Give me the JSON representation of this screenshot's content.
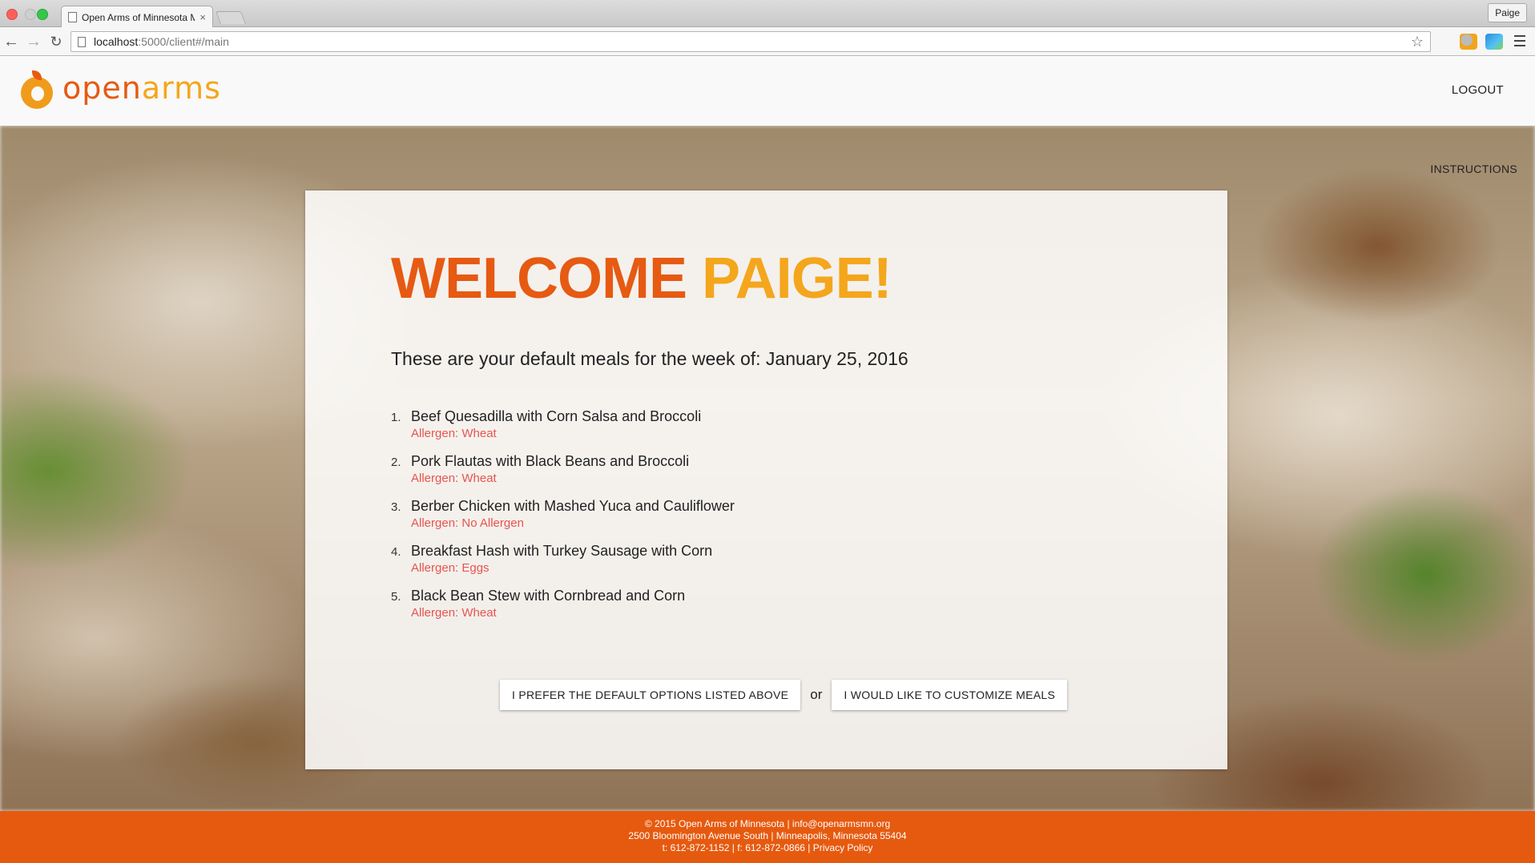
{
  "browser": {
    "tab_title": "Open Arms of Minnesota M",
    "tab_close": "×",
    "profile_name": "Paige",
    "url_host": "localhost",
    "url_rest": ":5000/client#/main"
  },
  "header": {
    "logo_open": "open",
    "logo_arms": "arms",
    "logout_label": "LOGOUT",
    "instructions_label": "INSTRUCTIONS"
  },
  "main": {
    "welcome_word": "WELCOME",
    "user_name": "PAIGE!",
    "subtitle_prefix": "These are your default meals for the week of:",
    "week_date": "January 25, 2016",
    "meals": [
      {
        "num": "1.",
        "name": "Beef Quesadilla with Corn Salsa and Broccoli",
        "allergen": "Allergen: Wheat"
      },
      {
        "num": "2.",
        "name": "Pork Flautas with Black Beans and Broccoli",
        "allergen": "Allergen: Wheat"
      },
      {
        "num": "3.",
        "name": "Berber Chicken with Mashed Yuca and Cauliflower",
        "allergen": "Allergen: No Allergen"
      },
      {
        "num": "4.",
        "name": "Breakfast Hash with Turkey Sausage with Corn",
        "allergen": "Allergen: Eggs"
      },
      {
        "num": "5.",
        "name": "Black Bean Stew with Cornbread and Corn",
        "allergen": "Allergen: Wheat"
      }
    ],
    "default_button": "I PREFER THE DEFAULT OPTIONS LISTED ABOVE",
    "or_text": "or",
    "customize_button": "I WOULD LIKE TO CUSTOMIZE MEALS"
  },
  "footer": {
    "line1": "© 2015 Open Arms of Minnesota | info@openarmsmn.org",
    "line2": "2500 Bloomington Avenue South | Minneapolis, Minnesota 55404",
    "line3": "t: 612-872-1152 | f: 612-872-0866 | Privacy Policy"
  },
  "colors": {
    "brand_orange": "#e65a12",
    "brand_yellow": "#f4a61c",
    "allergen_red": "#e8544e",
    "footer_bg": "#e65a0f"
  }
}
